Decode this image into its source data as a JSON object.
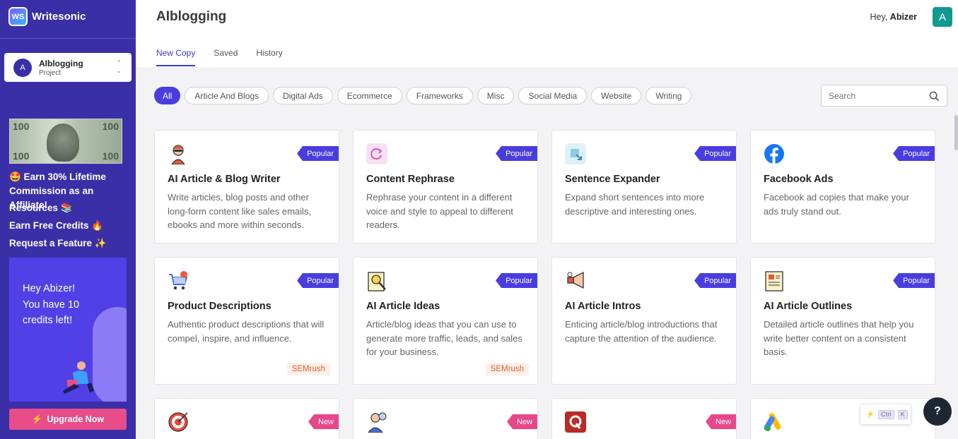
{
  "sidebar": {
    "logo_text": "Writesonic",
    "logo_mark": "WS",
    "project": {
      "avatar": "A",
      "name": "AIblogging",
      "sub": "Project"
    },
    "affiliate": "🤩 Earn 30% Lifetime Commission as an Affiliate!",
    "links": [
      "Resources 📚",
      "Earn Free Credits 🔥",
      "Request a Feature ✨"
    ],
    "credits_text": "Hey Abizer! You have 10 credits left!",
    "upgrade": "Upgrade Now",
    "dollar_numbers": [
      "100",
      "100",
      "100",
      "100"
    ]
  },
  "header": {
    "title": "AIblogging",
    "greeting_prefix": "Hey,",
    "greeting_name": "Abizer",
    "avatar": "A",
    "tabs": [
      "New Copy",
      "Saved",
      "History"
    ]
  },
  "filters": [
    "All",
    "Article And Blogs",
    "Digital Ads",
    "Ecommerce",
    "Frameworks",
    "Misc",
    "Social Media",
    "Website",
    "Writing"
  ],
  "search": {
    "placeholder": "Search"
  },
  "cards": [
    {
      "title": "AI Article & Blog Writer",
      "desc": "Write articles, blog posts and other long-form content like sales emails, ebooks and more within seconds.",
      "badge": "Popular",
      "icon": "writer-avatar-icon"
    },
    {
      "title": "Content Rephrase",
      "desc": "Rephrase your content in a different voice and style to appeal to different readers.",
      "badge": "Popular",
      "icon": "rephrase-icon"
    },
    {
      "title": "Sentence Expander",
      "desc": "Expand short sentences into more descriptive and interesting ones.",
      "badge": "Popular",
      "icon": "expand-icon"
    },
    {
      "title": "Facebook Ads",
      "desc": "Facebook ad copies that make your ads truly stand out.",
      "badge": "Popular",
      "icon": "facebook-icon"
    },
    {
      "title": "Product Descriptions",
      "desc": "Authentic product descriptions that will compel, inspire, and influence.",
      "badge": "Popular",
      "tag": "SEMrush",
      "icon": "shopping-cart-icon"
    },
    {
      "title": "AI Article Ideas",
      "desc": "Article/blog ideas that you can use to generate more traffic, leads, and sales for your business.",
      "badge": "Popular",
      "tag": "SEMrush",
      "icon": "idea-book-icon"
    },
    {
      "title": "AI Article Intros",
      "desc": "Enticing article/blog introductions that capture the attention of the audience.",
      "badge": "Popular",
      "icon": "megaphone-icon"
    },
    {
      "title": "AI Article Outlines",
      "desc": "Detailed article outlines that help you write better content on a consistent basis.",
      "badge": "Popular",
      "icon": "newspaper-icon"
    },
    {
      "title": "",
      "desc": "",
      "badge": "New",
      "icon": "target-icon"
    },
    {
      "title": "",
      "desc": "",
      "badge": "New",
      "icon": "analyst-icon"
    },
    {
      "title": "",
      "desc": "",
      "badge": "New",
      "icon": "quora-icon"
    },
    {
      "title": "",
      "desc": "",
      "badge": "",
      "icon": "google-ads-icon"
    }
  ],
  "shortcut": {
    "ctrl": "Ctrl",
    "k": "K"
  },
  "help": "?"
}
